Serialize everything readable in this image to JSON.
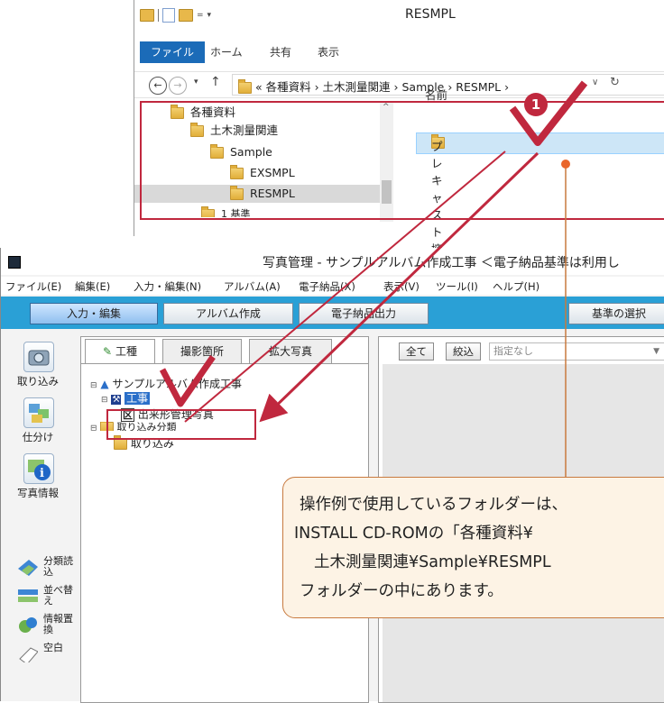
{
  "explorer": {
    "title": "RESMPL",
    "ribbon_tabs": [
      "ファイル",
      "ホーム",
      "共有",
      "表示"
    ],
    "breadcrumb": "« 各種資料 › 土木測量関連 › Sample › RESMPL ›",
    "tree": [
      "各種資料",
      "土木測量関連",
      "Sample",
      "EXSMPL",
      "RESMPL",
      "1 基準"
    ],
    "list_header": "名前",
    "list_item": "プレキャスト擁壁工"
  },
  "app": {
    "title": "写真管理 - サンプルアルバム作成工事 ＜電子納品基準は利用し",
    "menu": [
      "ファイル(E)",
      "編集(E)",
      "入力・編集(N)",
      "アルバム(A)",
      "電子納品(X)",
      "表示(V)",
      "ツール(I)",
      "ヘルプ(H)"
    ],
    "mode_tabs": [
      "入力・編集",
      "アルバム作成",
      "電子納品出力",
      "基準の選択"
    ],
    "left_tools": [
      "取り込み",
      "仕分け",
      "写真情報"
    ],
    "small_tools": [
      "分類読込",
      "並べ替え",
      "情報置換",
      "空白"
    ],
    "panel_tabs": [
      "工種",
      "撮影箇所",
      "拡大写真"
    ],
    "tree": [
      "サンプルアルバム作成工事",
      "工事",
      "出来形管理写真",
      "取り込み分類",
      "取り込み"
    ],
    "filter": {
      "all": "全て",
      "narrow": "絞込",
      "placeholder": "指定なし"
    }
  },
  "callout": {
    "lines": [
      "操作例で使用しているフォルダーは、",
      "INSTALL CD-ROMの「各種資料¥",
      "土木測量関連¥Sample¥RESMPL",
      "フォルダーの中にあります。"
    ]
  },
  "badge": "1",
  "colors": {
    "accent_red": "#c0283e",
    "tab_bar": "#2aa0d6",
    "callout_line": "#c87a3f"
  }
}
